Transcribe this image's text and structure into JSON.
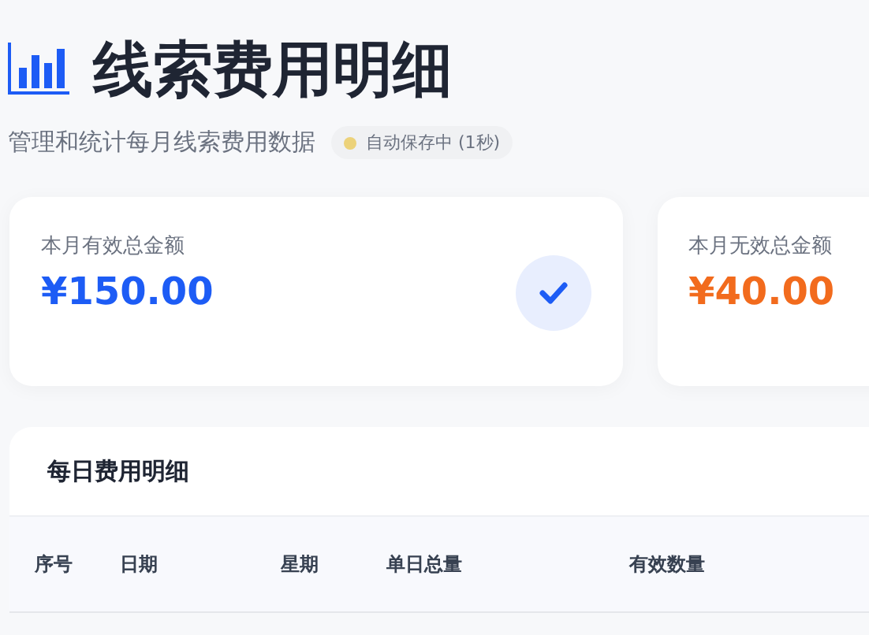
{
  "header": {
    "title": "线索费用明细",
    "subtitle": "管理和统计每月线索费用数据",
    "save_status": "自动保存中 (1秒)"
  },
  "summary_cards": [
    {
      "label": "本月有效总金额",
      "value": "¥150.00",
      "kind": "valid"
    },
    {
      "label": "本月无效总金额",
      "value": "¥40.00",
      "kind": "invalid"
    }
  ],
  "table": {
    "title": "每日费用明细",
    "columns": [
      "序号",
      "日期",
      "星期",
      "单日总量",
      "有效数量"
    ]
  }
}
